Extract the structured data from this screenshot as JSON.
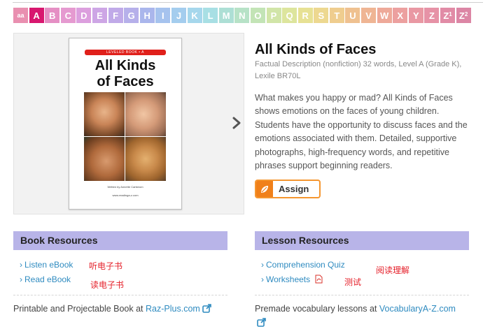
{
  "level_bar": {
    "levels": [
      {
        "label": "aa",
        "color": "#e98fb0"
      },
      {
        "label": "A",
        "color": "#d8176f"
      },
      {
        "label": "B",
        "color": "#e58fc4"
      },
      {
        "label": "C",
        "color": "#e59ad0"
      },
      {
        "label": "D",
        "color": "#dc9fde"
      },
      {
        "label": "E",
        "color": "#cda6e5"
      },
      {
        "label": "F",
        "color": "#c0aae8"
      },
      {
        "label": "G",
        "color": "#b6b0ea"
      },
      {
        "label": "H",
        "color": "#aab6ec"
      },
      {
        "label": "I",
        "color": "#a6c3ee"
      },
      {
        "label": "J",
        "color": "#a4cdee"
      },
      {
        "label": "K",
        "color": "#a6d7ec"
      },
      {
        "label": "L",
        "color": "#a8dfe4"
      },
      {
        "label": "M",
        "color": "#addfd5"
      },
      {
        "label": "N",
        "color": "#b7e2c7"
      },
      {
        "label": "O",
        "color": "#c3e4b6"
      },
      {
        "label": "P",
        "color": "#d1e5a8"
      },
      {
        "label": "Q",
        "color": "#dde59d"
      },
      {
        "label": "R",
        "color": "#e7e194"
      },
      {
        "label": "S",
        "color": "#edd890"
      },
      {
        "label": "T",
        "color": "#efcd8f"
      },
      {
        "label": "U",
        "color": "#efc190"
      },
      {
        "label": "V",
        "color": "#efb594"
      },
      {
        "label": "W",
        "color": "#eea999"
      },
      {
        "label": "X",
        "color": "#eca09f"
      },
      {
        "label": "Y",
        "color": "#e998a3"
      },
      {
        "label": "Z",
        "color": "#e692a6"
      },
      {
        "label": "Z",
        "sup": "1",
        "color": "#e18ba6"
      },
      {
        "label": "Z",
        "sup": "2",
        "color": "#dc86a5"
      }
    ]
  },
  "book": {
    "series_band": "LEVELED BOOK • A",
    "cover_title_line1": "All Kinds",
    "cover_title_line2": "of Faces",
    "cover_author": "Written by Annette Carlstrom",
    "cover_url": "www.readinga-z.com",
    "title": "All Kinds of Faces",
    "meta": "Factual Description (nonfiction) 32 words, Level A (Grade K), Lexile BR70L",
    "description": "What makes you happy or mad? All Kinds of Faces shows emotions on the faces of young children. Students have the opportunity to discuss faces and the emotions associated with them. Detailed, supportive photographs, high-frequency words, and repetitive phrases support beginning readers.",
    "assign_label": "Assign"
  },
  "book_resources": {
    "heading": "Book Resources",
    "links": [
      {
        "label": "Listen eBook",
        "note": "听电子书"
      },
      {
        "label": "Read eBook",
        "note": "读电子书"
      }
    ],
    "footer_text": "Printable and Projectable Book at ",
    "footer_link": "Raz-Plus.com"
  },
  "lesson_resources": {
    "heading": "Lesson Resources",
    "links": [
      {
        "label": "Comprehension Quiz",
        "note": "阅读理解"
      },
      {
        "label": "Worksheets",
        "note": "测试"
      }
    ],
    "footer_text": "Premade vocabulary lessons at ",
    "footer_link": "VocabularyA-Z.com"
  },
  "colors": {
    "accent_link": "#2f8bc0",
    "section_header": "#b8b4e8",
    "assign_orange": "#f0801a",
    "annotation_red": "#e5202a"
  }
}
